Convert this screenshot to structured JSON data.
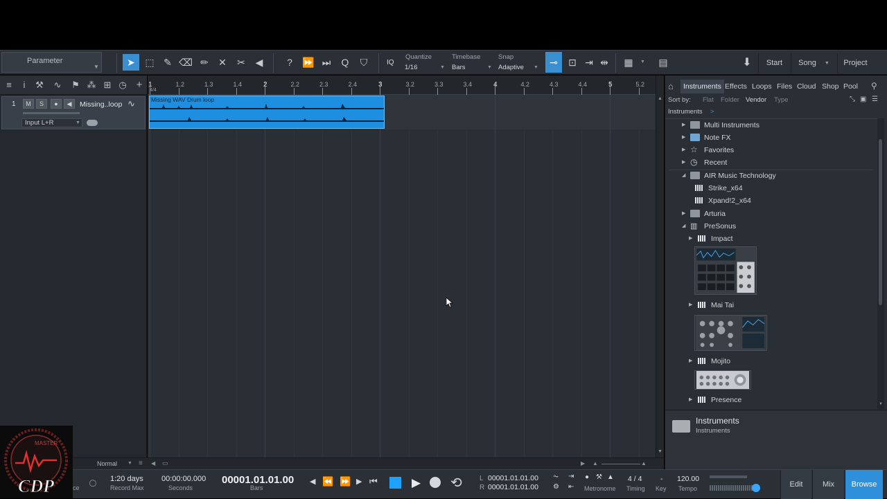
{
  "toolbar": {
    "parameter_label": "Parameter",
    "iq_label": "IQ",
    "quantize_caption": "Quantize",
    "quantize_value": "1/16",
    "timebase_caption": "Timebase",
    "timebase_value": "Bars",
    "snap_caption": "Snap",
    "snap_value": "Adaptive",
    "start_label": "Start",
    "song_label": "Song",
    "project_label": "Project",
    "tools": [
      "arrow-tool-icon",
      "range-tool-icon",
      "paint-tool-icon",
      "eraser-tool-icon",
      "pencil-tool-icon",
      "mute-tool-icon",
      "split-tool-icon",
      "listen-tool-icon"
    ]
  },
  "track": {
    "number": "1",
    "mute": "M",
    "solo": "S",
    "name": "Missing..loop",
    "input": "Input L+R"
  },
  "arrange": {
    "time_signature": "4/4",
    "event_title": "Missing WAV Drum loop",
    "ruler": [
      "1",
      "1.2",
      "1.3",
      "1.4",
      "2",
      "2.2",
      "2.3",
      "2.4",
      "3",
      "3.2",
      "3.3",
      "3.4",
      "4",
      "4.2",
      "4.3",
      "4.4",
      "5",
      "5.2"
    ],
    "zoom_mode": "Normal"
  },
  "browser": {
    "tabs": [
      "Instruments",
      "Effects",
      "Loops",
      "Files",
      "Cloud",
      "Shop",
      "Pool"
    ],
    "active_tab": "Instruments",
    "sort_by_label": "Sort by:",
    "sort_options": [
      "Flat",
      "Folder",
      "Vendor",
      "Type"
    ],
    "active_sort": "Vendor",
    "path": "Instruments",
    "path_sep": ">",
    "items": [
      {
        "label": "Multi Instruments",
        "icon": "folder-icon"
      },
      {
        "label": "Note FX",
        "icon": "folder-icon"
      },
      {
        "label": "Favorites",
        "icon": "star-icon"
      },
      {
        "label": "Recent",
        "icon": "clock-icon"
      },
      {
        "label": "AIR Music Technology",
        "icon": "folder-icon"
      },
      {
        "label": "Strike_x64",
        "icon": "keyboard-icon"
      },
      {
        "label": "Xpand!2_x64",
        "icon": "keyboard-icon"
      },
      {
        "label": "Arturia",
        "icon": "folder-icon"
      },
      {
        "label": "PreSonus",
        "icon": "vendor-icon"
      },
      {
        "label": "Impact",
        "icon": "keyboard-icon"
      },
      {
        "label": "Mai Tai",
        "icon": "keyboard-icon"
      },
      {
        "label": "Mojito",
        "icon": "keyboard-icon"
      },
      {
        "label": "Presence",
        "icon": "keyboard-icon"
      }
    ],
    "footer_title": "Instruments",
    "footer_sub": "Instruments"
  },
  "transport": {
    "record_max_value": "1:20 days",
    "record_max_caption": "Record Max",
    "seconds_value": "00:00:00.000",
    "seconds_caption": "Seconds",
    "bars_value": "00001.01.01.00",
    "bars_caption": "Bars",
    "left_locator": "00001.01.01.00",
    "right_locator": "00001.01.01.00",
    "l_label": "L",
    "r_label": "R",
    "metronome_caption": "Metronome",
    "timing_value": "4 / 4",
    "timing_caption": "Timing",
    "key_value": "-",
    "key_caption": "Key",
    "tempo_value": "120.00",
    "tempo_caption": "Tempo",
    "partial_left": "ce",
    "edit_label": "Edit",
    "mix_label": "Mix",
    "browse_label": "Browse"
  },
  "logo": {
    "text": "CDP",
    "arc_text": "MASTER"
  },
  "colors": {
    "accent": "#2e8fdb",
    "event": "#1e8fe0",
    "background": "#2a2f35"
  }
}
